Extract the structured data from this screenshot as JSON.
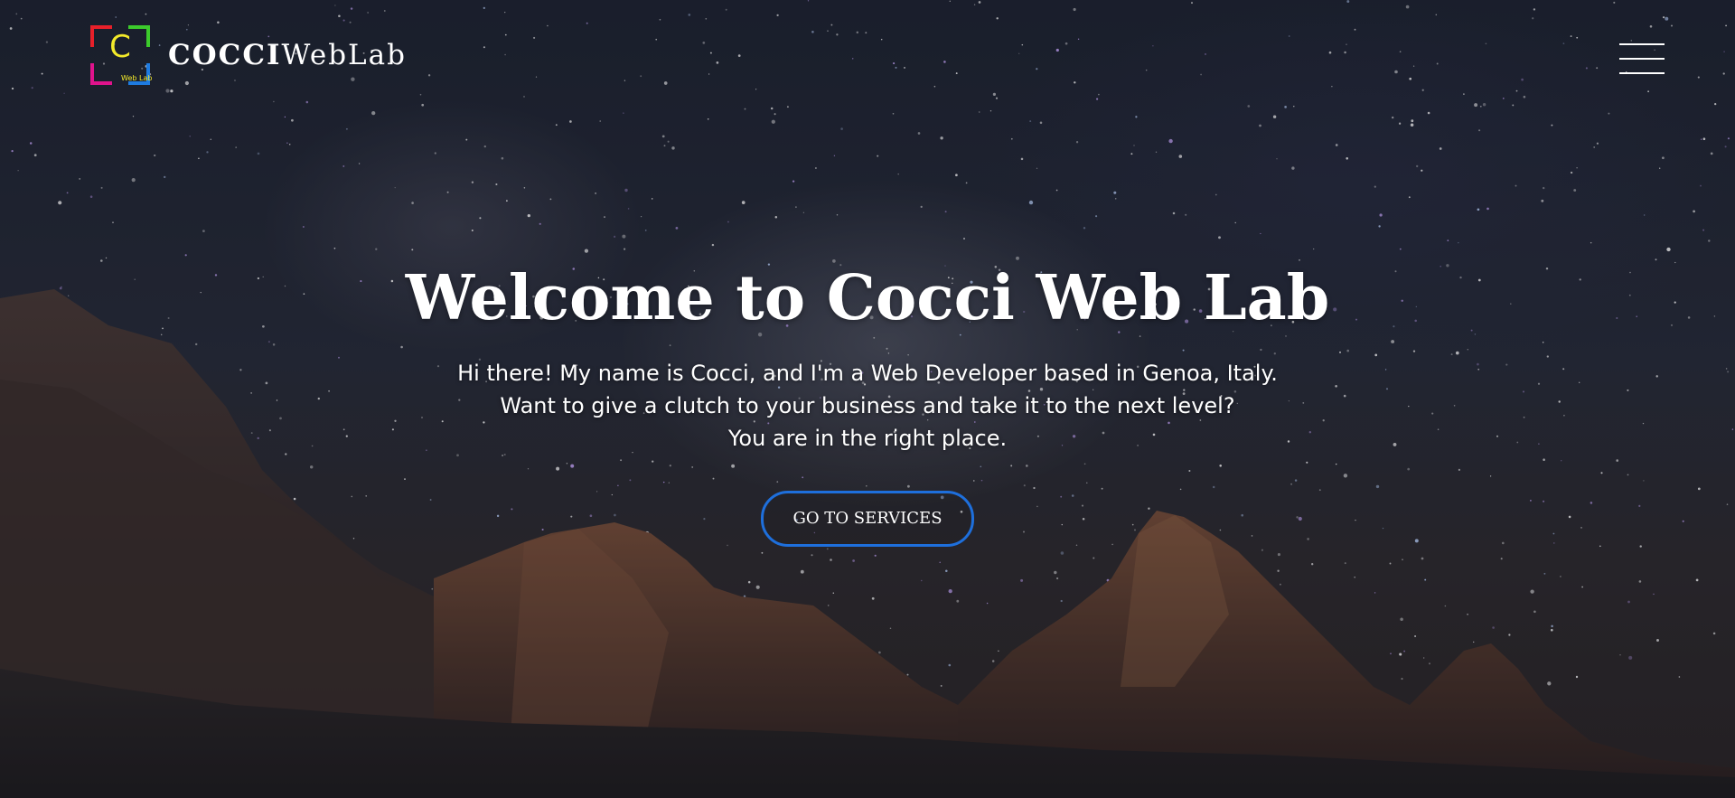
{
  "header": {
    "logo": {
      "letter": "C",
      "subtitle": "Web Lab",
      "corner_colors": [
        "#e8202a",
        "#3ccb2c",
        "#e0138c",
        "#1e7be0"
      ],
      "letter_color": "#f3ea2a"
    },
    "brand_bold": "COCCI",
    "brand_light": "WebLab",
    "menu_icon": "hamburger-menu-icon"
  },
  "hero": {
    "title": "Welcome to Cocci Web Lab",
    "intro_lines": [
      "Hi there! My name is Cocci, and I'm a Web Developer based in Genoa, Italy.",
      "Want to give a clutch to your business and take it to the next level?",
      "You are in the right place."
    ],
    "cta_label": "GO TO SERVICES",
    "cta_border_color": "#1e6fdc"
  }
}
